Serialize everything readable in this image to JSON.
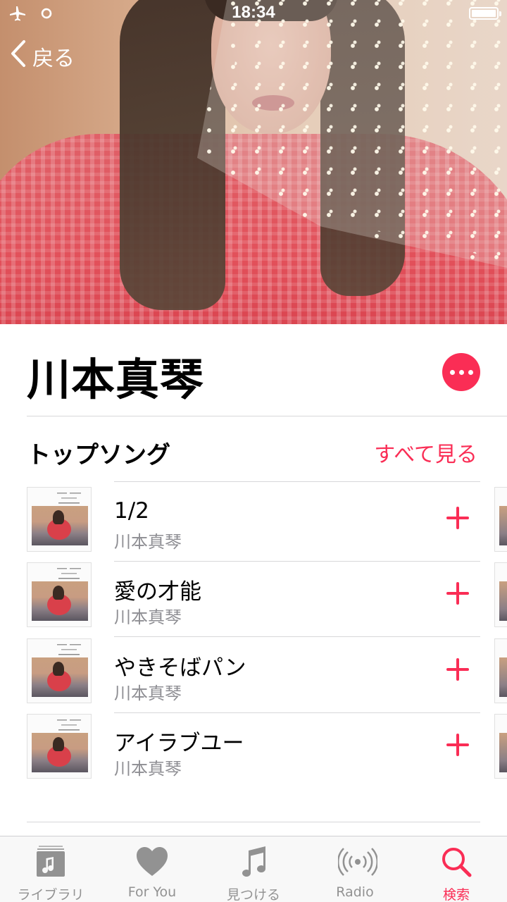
{
  "status_bar": {
    "time": "18:34",
    "battery_level": 1.0
  },
  "nav": {
    "back_label": "戻る"
  },
  "artist": {
    "name": "川本真琴"
  },
  "top_songs": {
    "section_title": "トップソング",
    "see_all_label": "すべて見る",
    "songs": [
      {
        "title": "1/2",
        "artist": "川本真琴"
      },
      {
        "title": "愛の才能",
        "artist": "川本真琴"
      },
      {
        "title": "やきそばパン",
        "artist": "川本真琴"
      },
      {
        "title": "アイラブユー",
        "artist": "川本真琴"
      }
    ]
  },
  "tab_bar": {
    "tabs": [
      {
        "label": "ライブラリ",
        "icon": "library-icon"
      },
      {
        "label": "For You",
        "icon": "heart-icon"
      },
      {
        "label": "見つける",
        "icon": "music-note-icon"
      },
      {
        "label": "Radio",
        "icon": "radio-icon"
      },
      {
        "label": "検索",
        "icon": "search-icon",
        "active": true
      }
    ]
  },
  "colors": {
    "accent": "#fa2d55",
    "secondary_text": "#8e8e93",
    "tab_inactive": "#929292",
    "tab_bar_bg": "#f8f8f8"
  }
}
